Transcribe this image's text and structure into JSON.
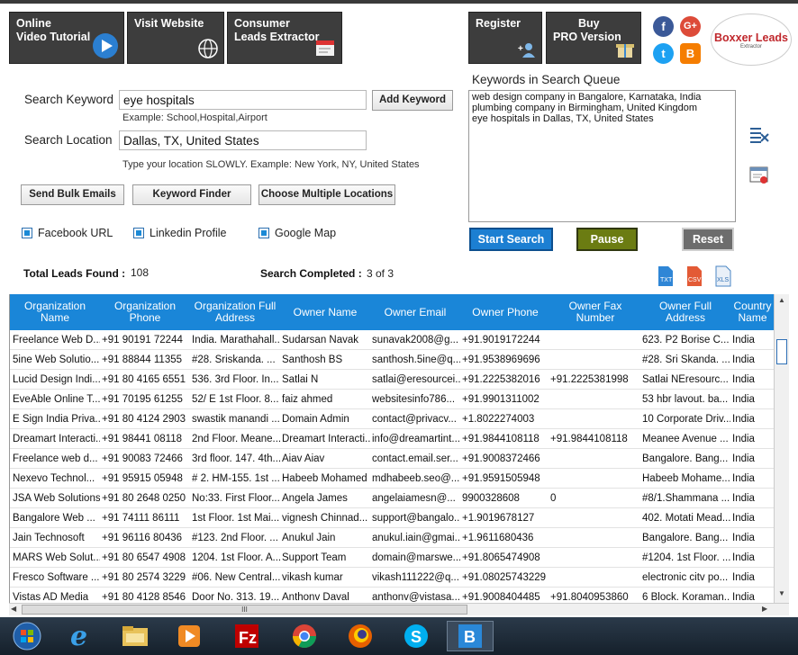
{
  "toolbar": {
    "video_tutorial": [
      "Online",
      "Video Tutorial"
    ],
    "visit_website": [
      "Visit Website"
    ],
    "leads_extractor": [
      "Consumer",
      "Leads Extractor"
    ],
    "register": [
      "Register"
    ],
    "buy_pro": [
      "Buy",
      "PRO Version"
    ],
    "logo_main": "Boxxer Leads",
    "logo_sub": "Extractor"
  },
  "form": {
    "search_keyword_label": "Search Keyword",
    "search_keyword_value": "eye hospitals",
    "keyword_example": "Example: School,Hospital,Airport",
    "search_location_label": "Search Location",
    "search_location_value": "Dallas, TX, United States",
    "location_hint": "Type your location SLOWLY. Example: New York, NY, United States",
    "add_keyword": "Add Keyword",
    "send_bulk_emails": "Send Bulk Emails",
    "keyword_finder": "Keyword Finder",
    "choose_multiple_locations": "Choose Multiple Locations",
    "facebook_url": "Facebook URL",
    "linkedin_profile": "Linkedin Profile",
    "google_map": "Google Map"
  },
  "queue": {
    "title": "Keywords in Search Queue",
    "items": [
      "web design company in Bangalore, Karnataka, India",
      "plumbing company in Birmingham, United Kingdom",
      "eye hospitals in Dallas, TX, United States"
    ]
  },
  "controls": {
    "start_search": "Start Search",
    "pause": "Pause",
    "reset": "Reset"
  },
  "stats": {
    "total_leads_label": "Total Leads Found :",
    "total_leads_value": "108",
    "search_completed_label": "Search Completed :",
    "search_completed_value": "3 of 3"
  },
  "grid": {
    "columns": [
      "Organization Name",
      "Organization Phone",
      "Organization Full Address",
      "Owner Name",
      "Owner Email",
      "Owner Phone",
      "Owner Fax Number",
      "Owner Full Address",
      "Country Name"
    ],
    "rows": [
      [
        "Freelance Web D...",
        "+91 90191 72244",
        "India. Marathahall...",
        "Sudarsan Navak",
        "sunavak2008@g...",
        "+91.9019172244",
        "",
        "623. P2 Borise C...",
        "India"
      ],
      [
        "5ine Web Solutio...",
        "+91 88844 11355",
        "#28. Sriskanda. ...",
        "Santhosh BS",
        "santhosh.5ine@q...",
        "+91.9538969696",
        "",
        "#28. Sri Skanda. ...",
        "India"
      ],
      [
        "Lucid Design Indi...",
        "+91 80 4165 6551",
        "536. 3rd Floor. In...",
        "Satlai N",
        "satlai@eresourcei...",
        "+91.2225382016",
        "+91.2225381998",
        "Satlai NEresourc...",
        "India"
      ],
      [
        "EveAble Online T...",
        "+91 70195 61255",
        "52/ E 1st Floor. 8...",
        "faiz ahmed",
        "websitesinfo786...",
        "+91.9901311002",
        "",
        "53 hbr lavout. ba...",
        "India"
      ],
      [
        "E Sign India Priva...",
        "+91 80 4124 2903",
        "swastik manandi ...",
        "Domain Admin",
        "contact@privacv...",
        "+1.8022274003",
        "",
        "10 Corporate Driv...",
        "India"
      ],
      [
        "Dreamart Interacti...",
        "+91 98441 08118",
        "2nd Floor. Meane...",
        "Dreamart Interacti...",
        "info@dreamartint...",
        "+91.9844108118",
        "+91.9844108118",
        "Meanee Avenue ...",
        "India"
      ],
      [
        "Freelance web d...",
        "+91 90083 72466",
        "3rd floor. 147. 4th...",
        "Aiav Aiav",
        "contact.email.ser...",
        "+91.9008372466",
        "",
        "Bangalore. Bang...",
        "India"
      ],
      [
        "Nexevo Technol...",
        "+91 95915 05948",
        "# 2. HM-155. 1st ...",
        "Habeeb Mohamed",
        "mdhabeeb.seo@...",
        "+91.9591505948",
        "",
        "Habeeb Mohame...",
        "India"
      ],
      [
        "JSA Web Solutions",
        "+91 80 2648 0250",
        "No:33. First Floor....",
        "Angela James",
        "angelaiamesn@...",
        "9900328608",
        "0",
        "#8/1.Shammana ...",
        "India"
      ],
      [
        "Bangalore Web ...",
        "+91 74111 86111",
        "1st Floor. 1st Mai...",
        "vignesh Chinnad...",
        "support@bangalo...",
        "+1.9019678127",
        "",
        "402. Motati Mead...",
        "India"
      ],
      [
        "Jain Technosoft",
        "+91 96116 80436",
        "#123. 2nd Floor. ...",
        "Anukul Jain",
        "anukul.iain@gmai...",
        "+1.9611680436",
        "",
        "Bangalore. Bang...",
        "India"
      ],
      [
        "MARS Web Solut...",
        "+91 80 6547 4908",
        "1204. 1st Floor. A...",
        "Support Team",
        "domain@marswe...",
        "+91.8065474908",
        "",
        "#1204. 1st Floor. ...",
        "India"
      ],
      [
        "Fresco Software ...",
        "+91 80 2574 3229",
        "#06. New Central...",
        "vikash kumar",
        "vikash111222@q...",
        "+91.08025743229",
        "",
        "electronic citv po...",
        "India"
      ],
      [
        "Vistas AD Media",
        "+91 80 4128 8546",
        "Door No. 313. 19...",
        "Anthonv Daval",
        "anthonv@vistasa...",
        "+91.9008404485",
        "+91.8040953860",
        "6 Block. Koraman...",
        "India"
      ]
    ]
  },
  "scroll": {
    "h_thumb_label": "III"
  },
  "colors": {
    "header_blue": "#1a86d8",
    "toolbar_dark": "#3d3d3d",
    "start_search": "#1c7fd2",
    "pause": "#6b7c12",
    "reset": "#6d6d6d"
  },
  "taskbar": {
    "items": [
      "start-orb-icon",
      "internet-explorer-icon",
      "file-explorer-icon",
      "media-player-icon",
      "filezilla-icon",
      "chrome-icon",
      "firefox-icon",
      "skype-icon",
      "leads-app-icon"
    ]
  }
}
